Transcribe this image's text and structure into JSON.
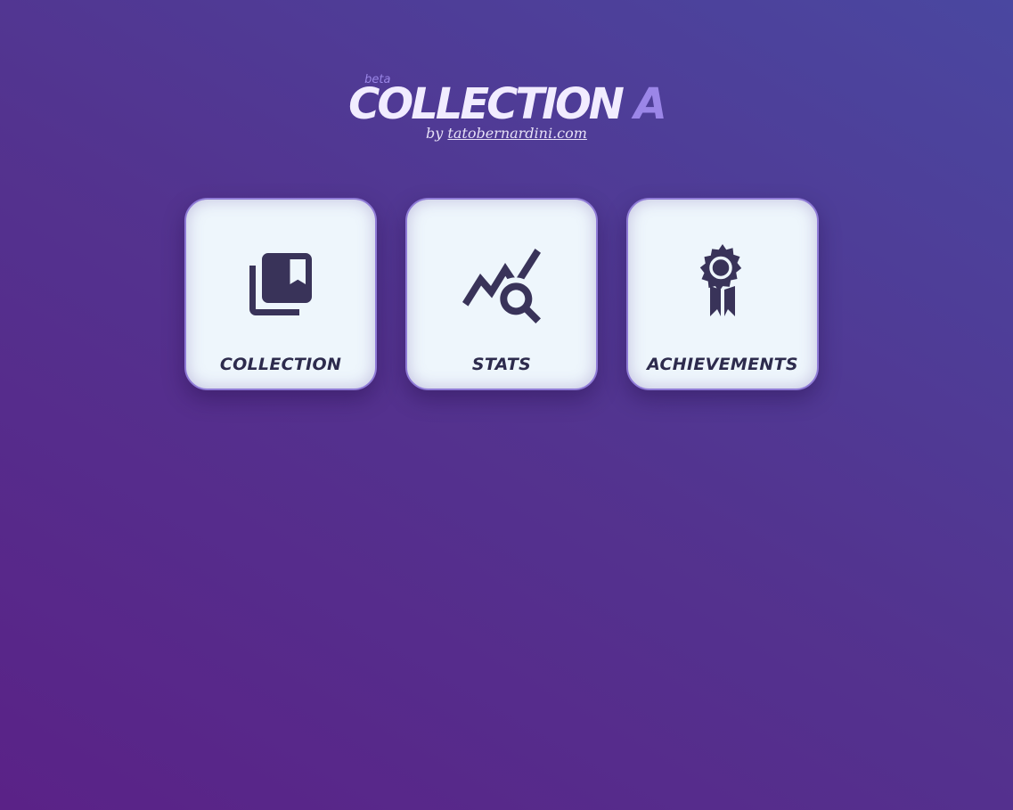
{
  "header": {
    "beta": "beta",
    "title_main": "COLLECTION ",
    "title_accent": "A",
    "by": "by ",
    "author_link": "tatobernardini.com"
  },
  "cards": [
    {
      "label": "COLLECTION",
      "icon": "library-bookmark-icon"
    },
    {
      "label": "STATS",
      "icon": "chart-search-icon"
    },
    {
      "label": "ACHIEVEMENTS",
      "icon": "award-ribbon-icon"
    }
  ],
  "colors": {
    "background_start": "#5a2287",
    "background_end": "#4a47a0",
    "card_bg": "#eef6fc",
    "card_border": "#8f7bd6",
    "icon": "#393359",
    "title_accent": "#9b86e8"
  }
}
